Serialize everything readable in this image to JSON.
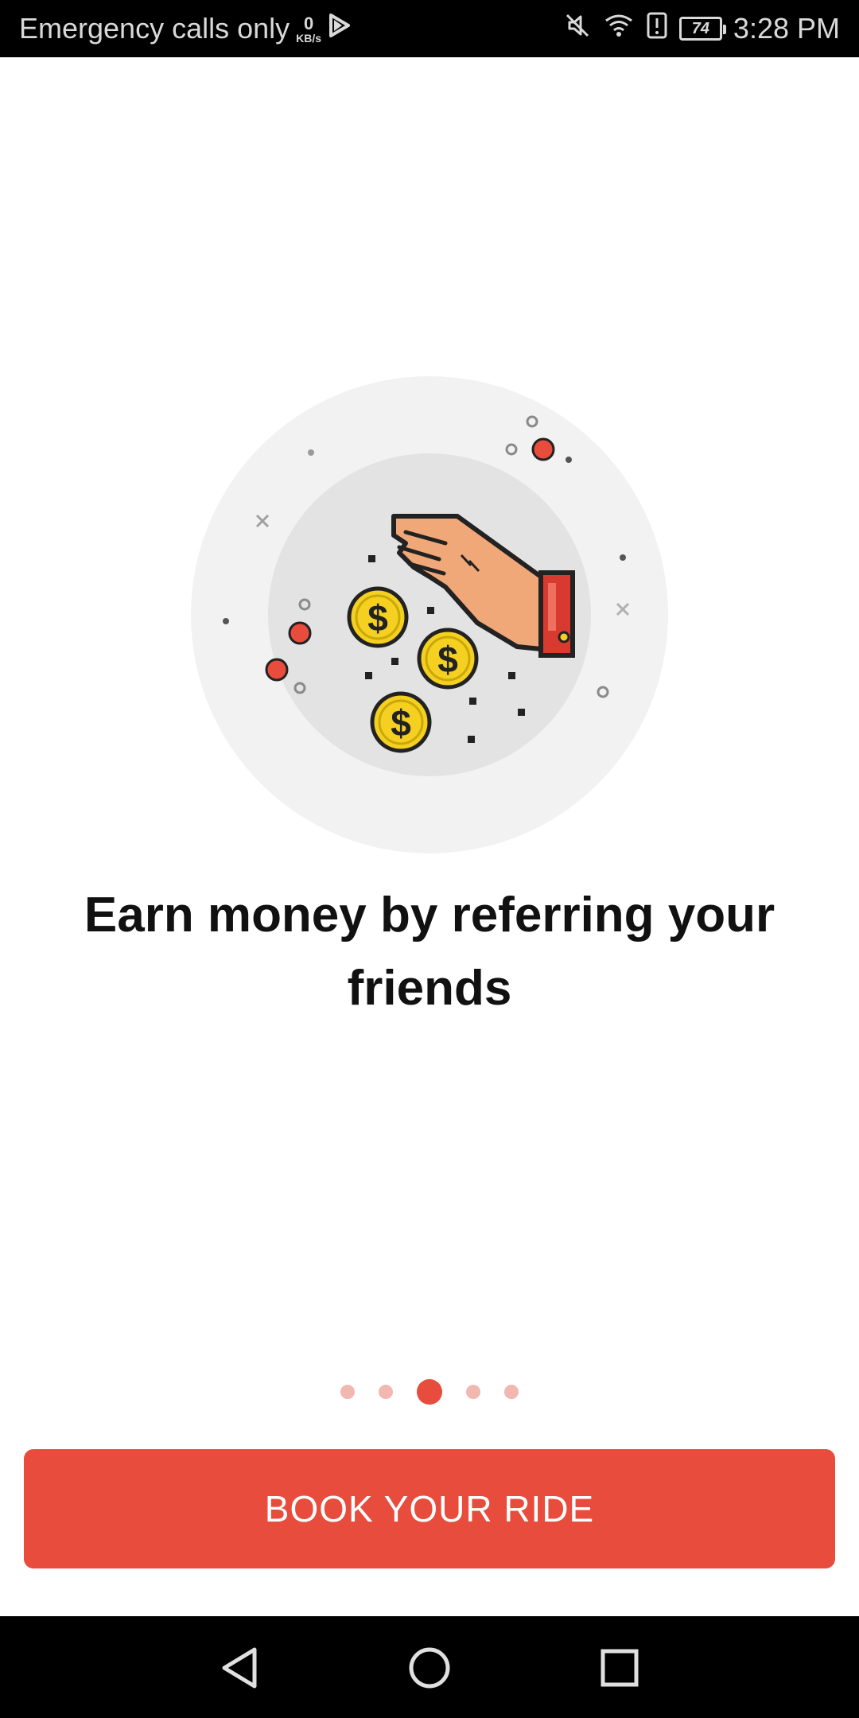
{
  "status_bar": {
    "carrier_text": "Emergency calls only",
    "net_speed_value": "0",
    "net_speed_unit": "KB/s",
    "battery_level": "74",
    "time": "3:28 PM",
    "icons": [
      "play-store-icon",
      "mute-icon",
      "wifi-icon",
      "alert-icon",
      "battery-icon"
    ]
  },
  "onboarding": {
    "illustration": "hand-dropping-coins-icon",
    "title": "Earn money by referring your friends",
    "pager": {
      "total": 5,
      "active_index": 2
    },
    "cta_label": "BOOK YOUR RIDE"
  },
  "nav_bar": {
    "icons": [
      "back-icon",
      "home-icon",
      "recents-icon"
    ]
  },
  "colors": {
    "accent": "#e74c3c",
    "accent_light": "#f2b7b0",
    "coin": "#f5d020",
    "skin": "#f0a878",
    "cuff": "#d93a30"
  }
}
